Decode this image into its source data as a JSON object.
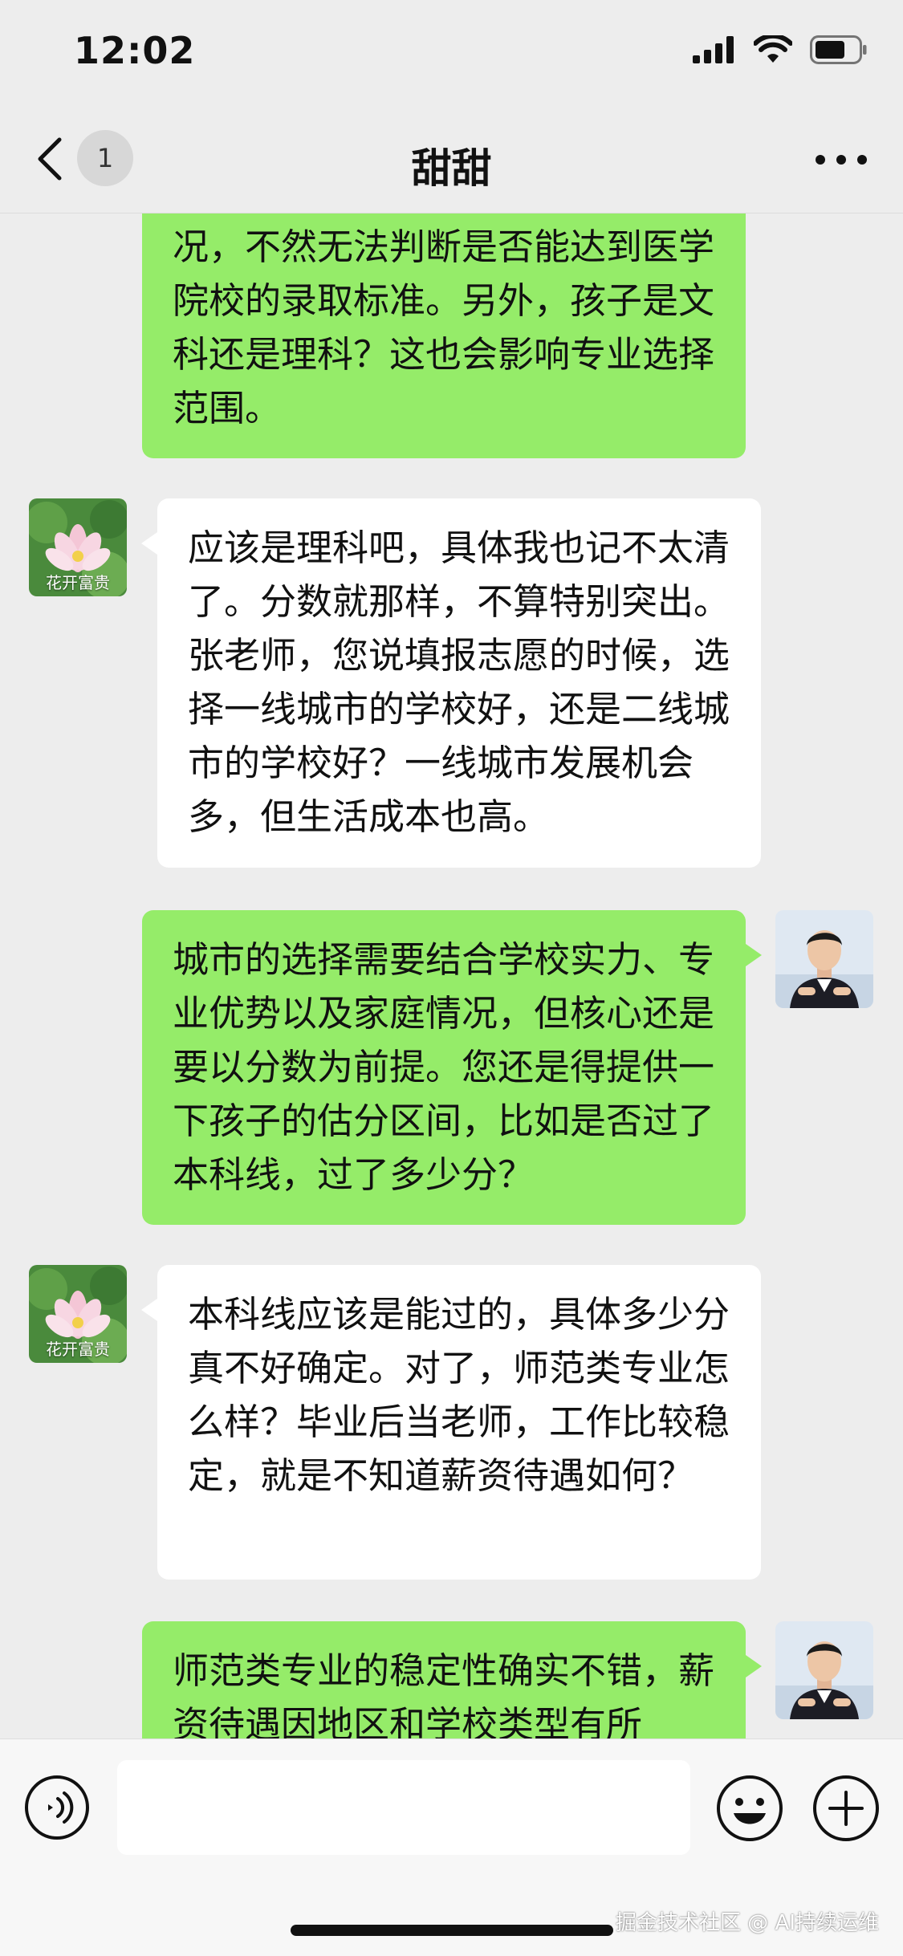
{
  "status_bar": {
    "time": "12:02"
  },
  "nav": {
    "title": "甜甜",
    "unread_count": "1"
  },
  "messages": [
    {
      "side": "out",
      "text": "况，不然无法判断是否能达到医学院校的录取标准。另外，孩子是文科还是理科？这也会影响专业选择范围。"
    },
    {
      "side": "in",
      "avatar_caption": "花开富贵",
      "text": "应该是理科吧，具体我也记不太清了。分数就那样，不算特别突出。张老师，您说填报志愿的时候，选择一线城市的学校好，还是二线城市的学校好？一线城市发展机会多，但生活成本也高。"
    },
    {
      "side": "out",
      "text": "城市的选择需要结合学校实力、专业优势以及家庭情况，但核心还是要以分数为前提。您还是得提供一下孩子的估分区间，比如是否过了本科线，过了多少分？"
    },
    {
      "side": "in",
      "avatar_caption": "花开富贵",
      "text": "本科线应该是能过的，具体多少分真不好确定。对了，师范类专业怎么样？毕业后当老师，工作比较稳定，就是不知道薪资待遇如何？"
    },
    {
      "side": "out",
      "text": "师范类专业的稳定性确实不错，薪资待遇因地区和学校类型有所"
    }
  ],
  "input": {
    "value": "",
    "placeholder": ""
  },
  "watermark": "掘金技术社区 @ AI持续运维",
  "colors": {
    "outgoing_bubble": "#95ec69",
    "incoming_bubble": "#ffffff",
    "background": "#ededed"
  }
}
